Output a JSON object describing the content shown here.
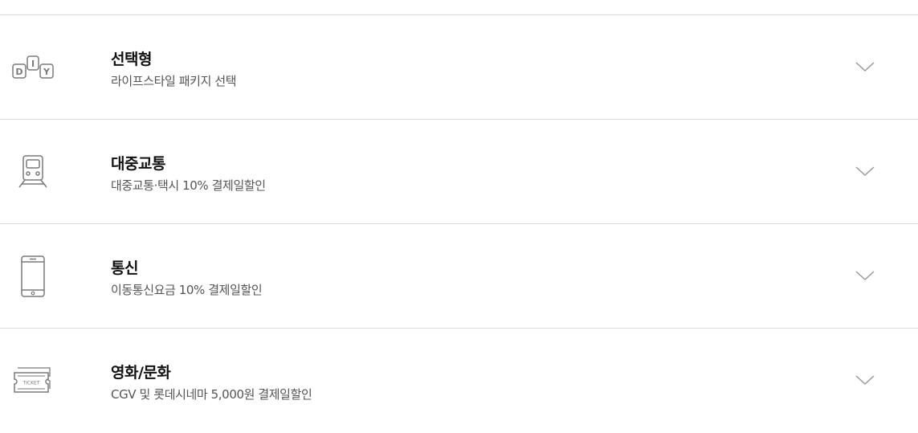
{
  "benefits": {
    "items": [
      {
        "id": "diy",
        "icon": "diy-blocks-icon",
        "title": "선택형",
        "description": "라이프스타일 패키지 선택"
      },
      {
        "id": "transit",
        "icon": "train-icon",
        "title": "대중교통",
        "description": "대중교통·택시 10% 결제일할인"
      },
      {
        "id": "mobile",
        "icon": "smartphone-icon",
        "title": "통신",
        "description": "이동통신요금 10% 결제일할인"
      },
      {
        "id": "movie",
        "icon": "ticket-icon",
        "title": "영화/문화",
        "description": "CGV 및 롯데시네마 5,000원 결제일할인"
      }
    ],
    "icon_text": {
      "d": "D",
      "i": "I",
      "y": "Y",
      "ticket": "TICKET"
    },
    "colors": {
      "divider": "#dcdcdc",
      "title": "#111111",
      "description": "#555555",
      "icon": "#7a7a7a",
      "chevron": "#9a9a9a"
    }
  }
}
